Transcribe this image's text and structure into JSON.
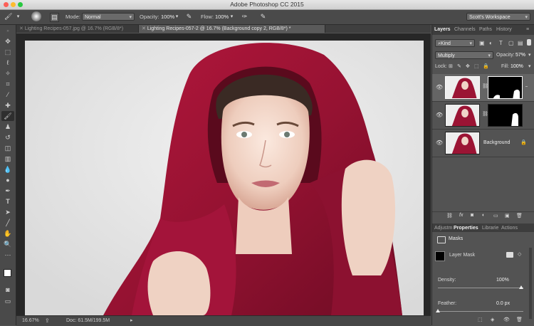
{
  "window": {
    "title": "Adobe Photoshop CC 2015"
  },
  "options_bar": {
    "brush_size": "200",
    "mode_label": "Mode:",
    "mode_value": "Normal",
    "opacity_label": "Opacity:",
    "opacity_value": "100%",
    "flow_label": "Flow:",
    "flow_value": "100%",
    "workspace": "Scott's Workspace"
  },
  "doc_tabs": [
    {
      "label": "Lighting Recipes-057.jpg @ 16.7% (RGB/8*)"
    },
    {
      "label": "Lighting Recipes-057-2 @ 16.7% (Background copy 2, RGB/8*) *"
    }
  ],
  "status": {
    "zoom": "16.67%",
    "doc": "Doc: 61.5M/199.5M"
  },
  "layers_panel": {
    "tabs": [
      "Layers",
      "Channels",
      "Paths",
      "History"
    ],
    "filter_kind": "Kind",
    "blend_mode": "Multiply",
    "opacity_label": "Opacity:",
    "opacity_value": "57%",
    "lock_label": "Lock:",
    "fill_label": "Fill:",
    "fill_value": "100%",
    "layers": [
      {
        "name": ""
      },
      {
        "name": ""
      },
      {
        "name": "Background"
      }
    ]
  },
  "properties_panel": {
    "tabs": [
      "Adjustm",
      "Properties",
      "Librarie",
      "Actions"
    ],
    "section": "Masks",
    "mask_type": "Layer Mask",
    "density_label": "Density:",
    "density_value": "100%",
    "feather_label": "Feather:",
    "feather_value": "0.0 px"
  },
  "colors": {
    "scarf": "#9b1434",
    "background_gray": "#ebebeb",
    "panel_bg": "#535353",
    "toolbar_bg": "#4a4a4a"
  }
}
